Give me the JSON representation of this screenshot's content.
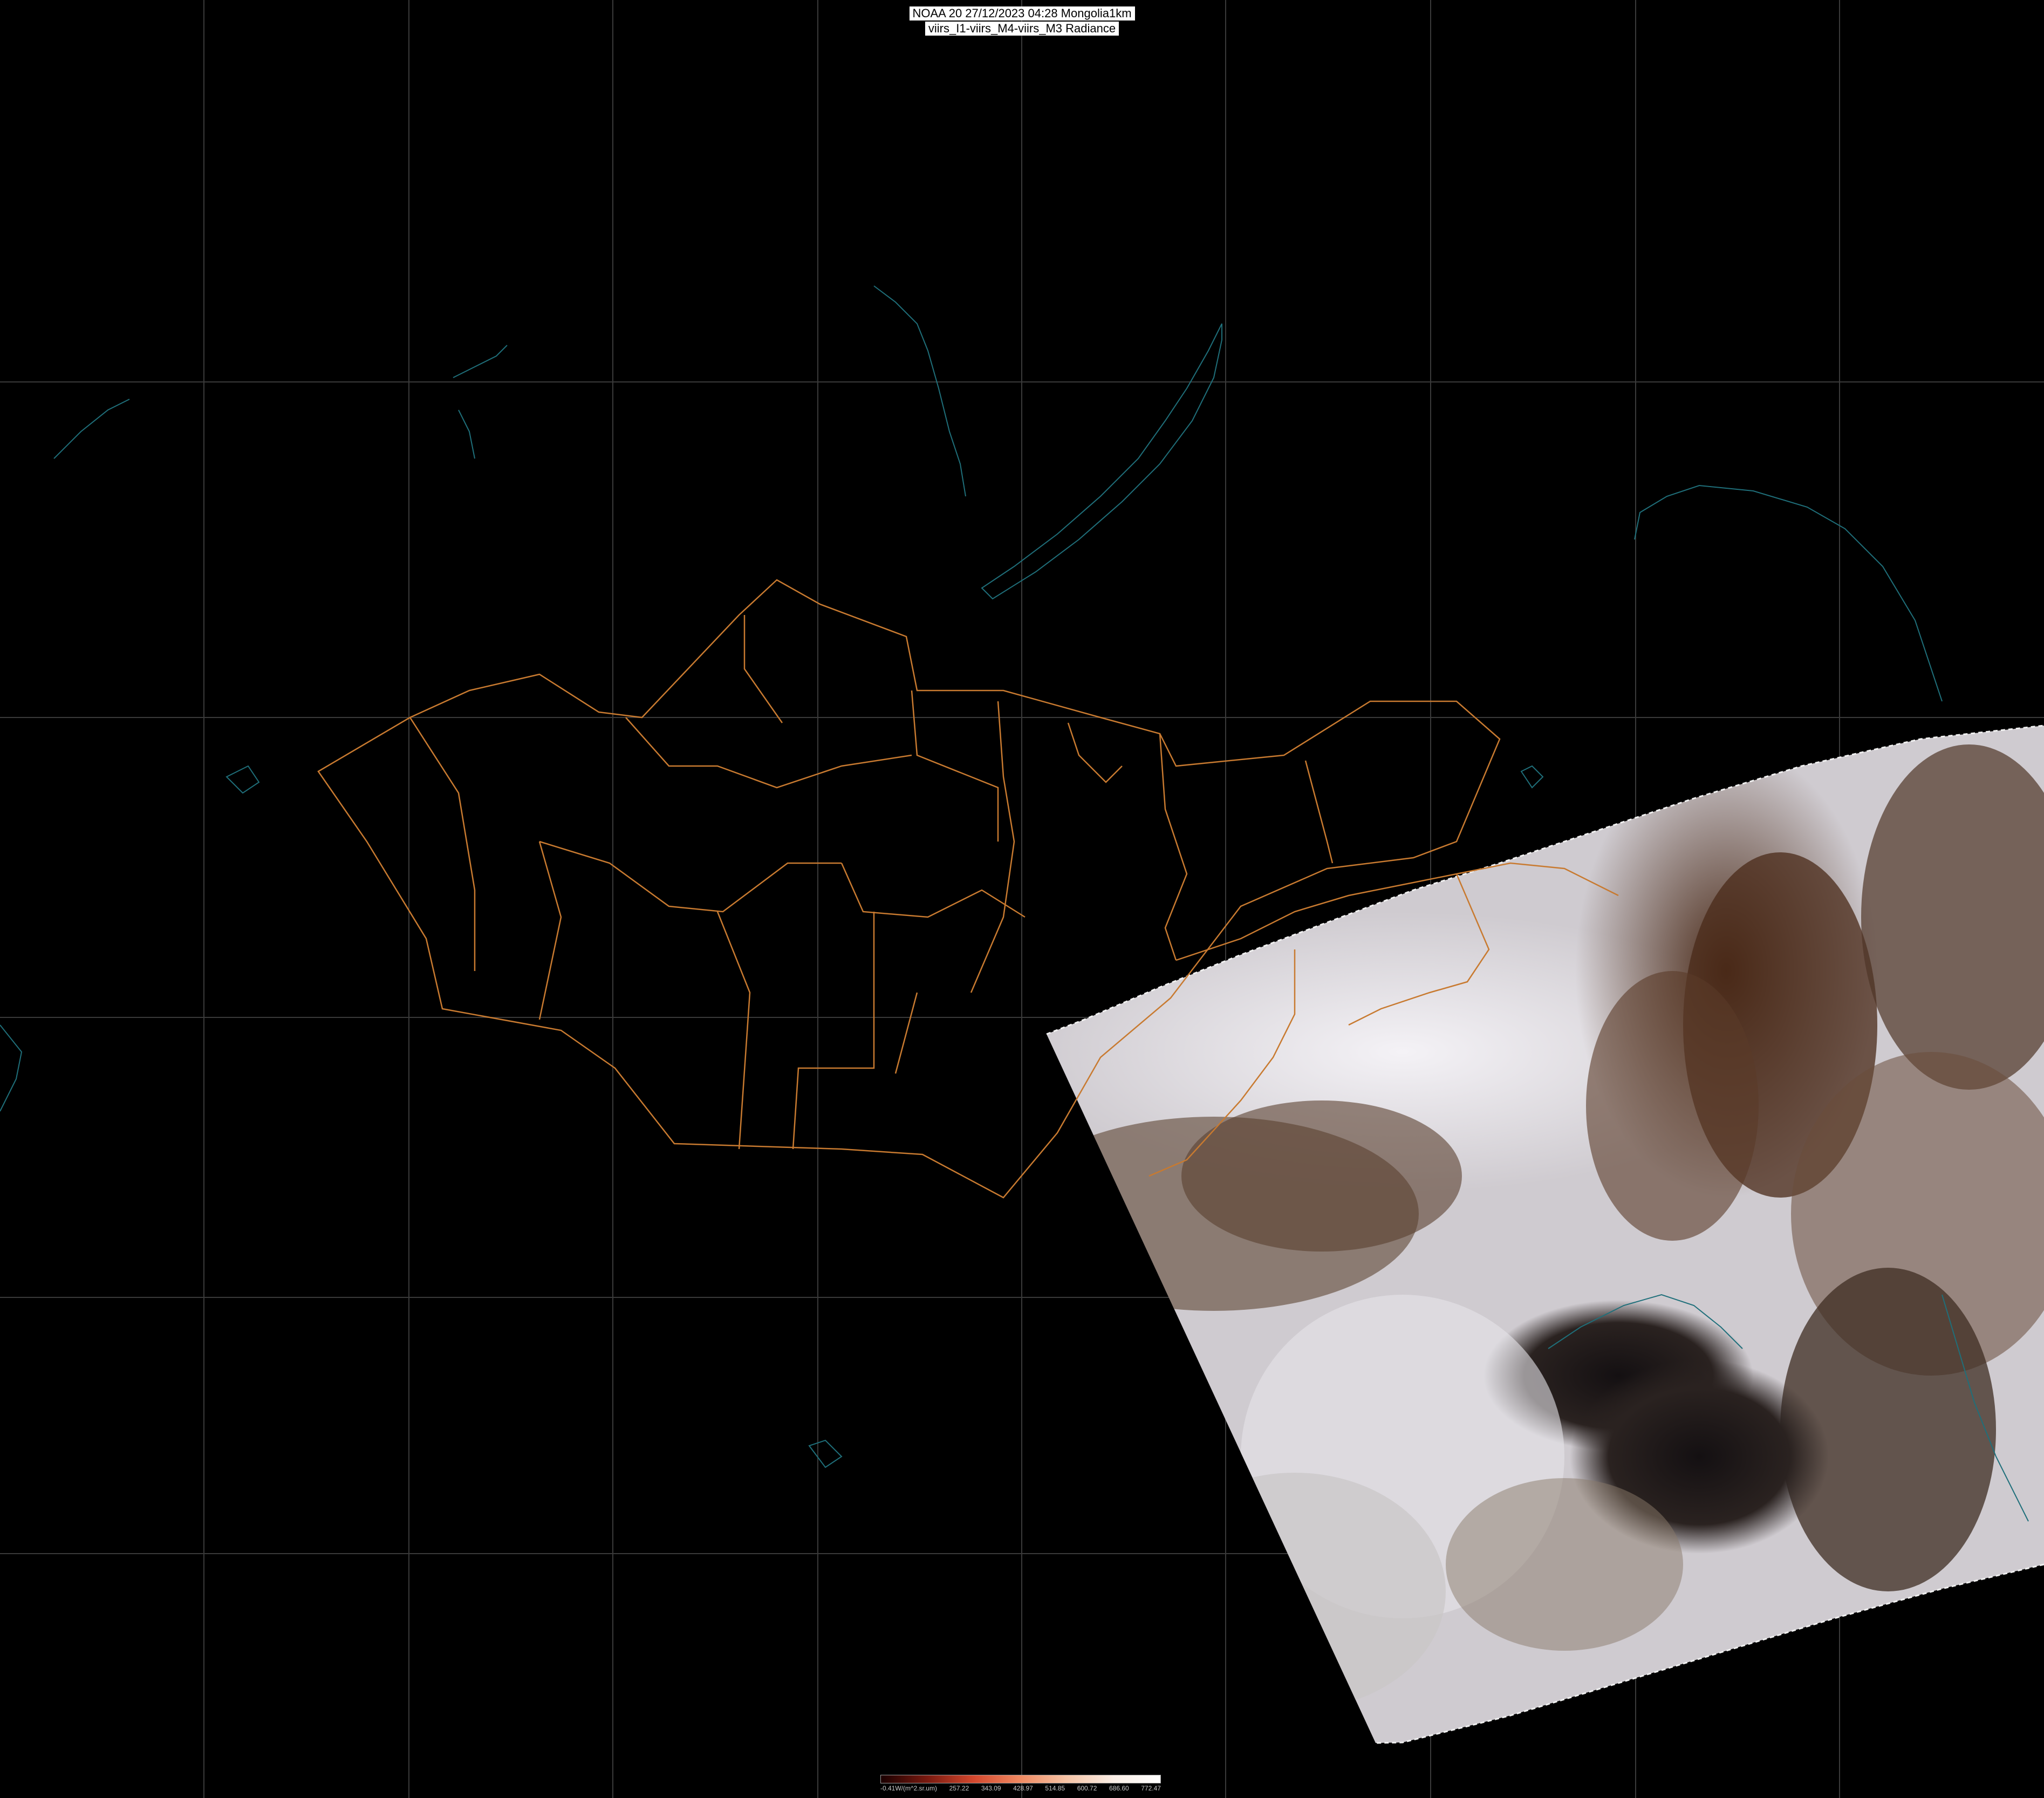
{
  "title": {
    "line1": "NOAA 20 27/12/2023 04:28 Mongolia1km",
    "line2": "viirs_I1-viirs_M4-viirs_M3 Radiance"
  },
  "colorbar": {
    "unit": "W/(m^2.sr.um)",
    "labels": [
      "-0.41W/(m^2.sr.um)",
      "257.22",
      "343.09",
      "428.97",
      "514.85",
      "600.72",
      "686.60",
      "772.47"
    ],
    "gradient_colors": [
      "#1a0000",
      "#7a1a10",
      "#d4482e",
      "#f08a62",
      "#f6c4a6",
      "#faeee6",
      "#ffffff"
    ]
  },
  "colors": {
    "background": "#000000",
    "graticule": "#3a3a3a",
    "admin_boundary": "#c87a30",
    "coastline": "#1f6f7a",
    "snow": "#e8e6ea",
    "bare_ground": "#5a3a28",
    "sea": "#1e1a1c"
  }
}
